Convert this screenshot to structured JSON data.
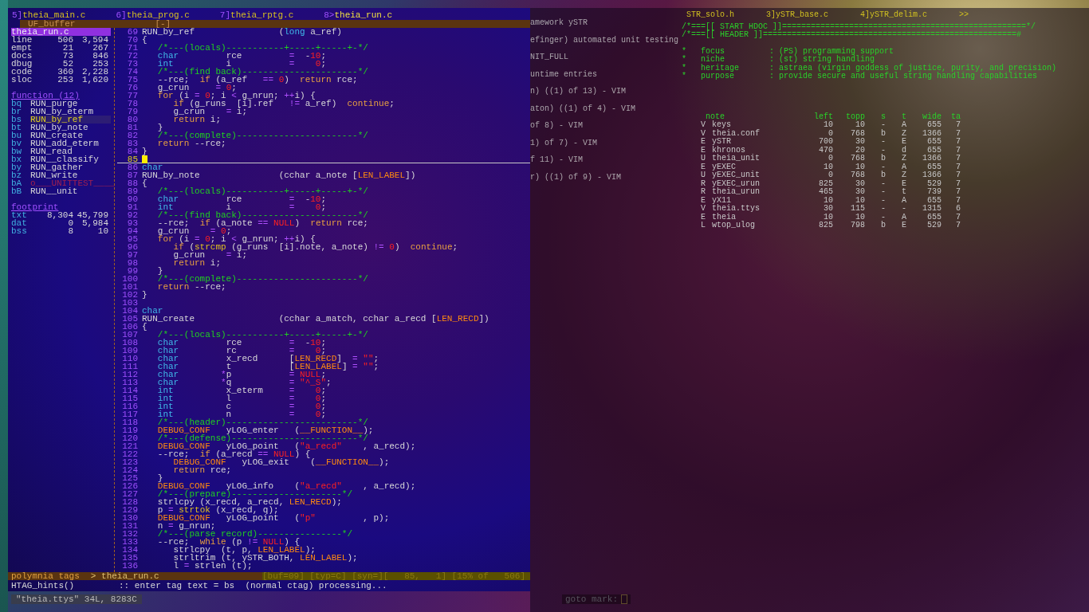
{
  "vim": {
    "tabs": [
      {
        "num": "5]",
        "name": "theia_main.c",
        "selected": false
      },
      {
        "num": "6]",
        "name": "theia_prog.c",
        "selected": false
      },
      {
        "num": "7]",
        "name": "theia_rptg.c",
        "selected": false
      },
      {
        "num": "8>",
        "name": "theia_run.c",
        "selected": true
      }
    ],
    "buffer_bar": {
      "title": "UF_buffer",
      "flag": "[-]"
    },
    "sidebar": {
      "file": "theia_run.c",
      "stats": [
        {
          "label": "line",
          "a": "506",
          "b": "3,594"
        },
        {
          "label": "empt",
          "a": "21",
          "b": "267"
        },
        {
          "label": "docs",
          "a": "73",
          "b": "846"
        },
        {
          "label": "dbug",
          "a": "52",
          "b": "253"
        },
        {
          "label": "code",
          "a": "360",
          "b": "2,228"
        },
        {
          "label": "sloc",
          "a": "253",
          "b": "1,620"
        }
      ],
      "functions_heading": "function (12)",
      "functions": [
        {
          "key": "bq",
          "name": "RUN_purge",
          "selected": false,
          "disabled": false
        },
        {
          "key": "br",
          "name": "RUN_by_eterm",
          "selected": false,
          "disabled": false
        },
        {
          "key": "bs",
          "name": "RUN_by_ref",
          "selected": true,
          "disabled": false
        },
        {
          "key": "bt",
          "name": "RUN_by_note",
          "selected": false,
          "disabled": false
        },
        {
          "key": "bu",
          "name": "RUN_create",
          "selected": false,
          "disabled": false
        },
        {
          "key": "bv",
          "name": "RUN_add_eterm",
          "selected": false,
          "disabled": false
        },
        {
          "key": "bw",
          "name": "RUN_read",
          "selected": false,
          "disabled": false
        },
        {
          "key": "bx",
          "name": "RUN__classify",
          "selected": false,
          "disabled": false
        },
        {
          "key": "by",
          "name": "RUN_gather",
          "selected": false,
          "disabled": false
        },
        {
          "key": "bz",
          "name": "RUN_write",
          "selected": false,
          "disabled": false
        },
        {
          "key": "bA",
          "name": "o___UNITTEST____",
          "selected": false,
          "disabled": true
        },
        {
          "key": "bB",
          "name": "RUN__unit",
          "selected": false,
          "disabled": false
        }
      ],
      "footprint_heading": "footprint",
      "footprint": [
        {
          "label": "txt",
          "a": "8,304",
          "b": "45,799"
        },
        {
          "label": "dat",
          "a": "0",
          "b": "5,984"
        },
        {
          "label": "bss",
          "a": "8",
          "b": "10"
        }
      ]
    },
    "lines": [
      {
        "num": "69",
        "current": false,
        "segments": [
          "RUN_by_ref                (",
          {
            "kind": "type",
            "text": "long"
          },
          " a_ref)"
        ]
      },
      {
        "num": "70",
        "current": false,
        "segments": [
          "{"
        ]
      },
      {
        "num": "71",
        "current": false,
        "segments": [
          {
            "kind": "comment",
            "text": "   /*---(locals)-----------+-----+-----+-*/"
          }
        ]
      },
      {
        "num": "72",
        "current": false,
        "segments": [
          {
            "kind": "type",
            "text": "   char"
          },
          "         rce         ",
          {
            "kind": "op",
            "text": "="
          },
          "  -",
          {
            "kind": "number",
            "text": "10"
          },
          ";"
        ]
      },
      {
        "num": "73",
        "current": false,
        "segments": [
          {
            "kind": "type",
            "text": "   int"
          },
          "          i           ",
          {
            "kind": "op",
            "text": "="
          },
          {
            "kind": "number",
            "text": "    0"
          },
          ";"
        ]
      },
      {
        "num": "74",
        "current": false,
        "segments": [
          {
            "kind": "comment",
            "text": "   /*---(find back)----------------------*/"
          }
        ]
      },
      {
        "num": "75",
        "current": false,
        "segments": [
          "   --rce;  ",
          {
            "kind": "keyword",
            "text": "if"
          },
          " (a_ref   ",
          {
            "kind": "op",
            "text": "=="
          },
          {
            "kind": "number",
            "text": " 0"
          },
          ")  ",
          {
            "kind": "keyword",
            "text": "return"
          },
          " rce;"
        ]
      },
      {
        "num": "76",
        "current": false,
        "segments": [
          "   g_crun     ",
          {
            "kind": "op",
            "text": "="
          },
          {
            "kind": "number",
            "text": " 0"
          },
          ";"
        ]
      },
      {
        "num": "77",
        "current": false,
        "segments": [
          {
            "kind": "keyword",
            "text": "   for"
          },
          " (i ",
          {
            "kind": "op",
            "text": "="
          },
          {
            "kind": "number",
            "text": " 0"
          },
          "; i ",
          {
            "kind": "op",
            "text": "<"
          },
          " g_nrun; ",
          {
            "kind": "op",
            "text": "++"
          },
          "i) {"
        ]
      },
      {
        "num": "78",
        "current": false,
        "segments": [
          {
            "kind": "keyword",
            "text": "      if"
          },
          " (g_runs  [i].ref   ",
          {
            "kind": "op",
            "text": "!="
          },
          " a_ref)  ",
          {
            "kind": "keyword",
            "text": "continue"
          },
          ";"
        ]
      },
      {
        "num": "79",
        "current": false,
        "segments": [
          "      g_crun    ",
          {
            "kind": "op",
            "text": "="
          },
          " i;"
        ]
      },
      {
        "num": "80",
        "current": false,
        "segments": [
          {
            "kind": "keyword",
            "text": "      return"
          },
          " i;"
        ]
      },
      {
        "num": "81",
        "current": false,
        "segments": [
          "   }"
        ]
      },
      {
        "num": "82",
        "current": false,
        "segments": [
          {
            "kind": "comment",
            "text": "   /*---(complete)-----------------------*/"
          }
        ]
      },
      {
        "num": "83",
        "current": false,
        "segments": [
          {
            "kind": "keyword",
            "text": "   return"
          },
          " --rce;"
        ]
      },
      {
        "num": "84",
        "current": false,
        "segments": [
          "}"
        ]
      },
      {
        "num": "85",
        "current": true
      },
      {
        "num": "86",
        "current": false,
        "segments": [
          {
            "kind": "type",
            "text": "char"
          }
        ]
      },
      {
        "num": "87",
        "current": false,
        "segments": [
          "RUN_by_note               (cchar a_note [",
          {
            "kind": "macro",
            "text": "LEN_LABEL"
          },
          "])"
        ]
      },
      {
        "num": "88",
        "current": false,
        "segments": [
          "{"
        ]
      },
      {
        "num": "89",
        "current": false,
        "segments": [
          {
            "kind": "comment",
            "text": "   /*---(locals)-----------+-----+-----+-*/"
          }
        ]
      },
      {
        "num": "90",
        "current": false,
        "segments": [
          {
            "kind": "type",
            "text": "   char"
          },
          "         rce         ",
          {
            "kind": "op",
            "text": "="
          },
          "  -",
          {
            "kind": "number",
            "text": "10"
          },
          ";"
        ]
      },
      {
        "num": "91",
        "current": false,
        "segments": [
          {
            "kind": "type",
            "text": "   int"
          },
          "          i           ",
          {
            "kind": "op",
            "text": "="
          },
          {
            "kind": "number",
            "text": "    0"
          },
          ";"
        ]
      },
      {
        "num": "92",
        "current": false,
        "segments": [
          {
            "kind": "comment",
            "text": "   /*---(find back)----------------------*/"
          }
        ]
      },
      {
        "num": "93",
        "current": false,
        "segments": [
          "   --rce;  ",
          {
            "kind": "keyword",
            "text": "if"
          },
          " (a_note ",
          {
            "kind": "op",
            "text": "=="
          },
          {
            "kind": "number",
            "text": " NULL"
          },
          ")  ",
          {
            "kind": "keyword",
            "text": "return"
          },
          " rce;"
        ]
      },
      {
        "num": "94",
        "current": false,
        "segments": [
          "   g_crun    ",
          {
            "kind": "op",
            "text": "="
          },
          {
            "kind": "number",
            "text": " 0"
          },
          ";"
        ]
      },
      {
        "num": "95",
        "current": false,
        "segments": [
          {
            "kind": "keyword",
            "text": "   for"
          },
          " (i ",
          {
            "kind": "op",
            "text": "="
          },
          {
            "kind": "number",
            "text": " 0"
          },
          "; i ",
          {
            "kind": "op",
            "text": "<"
          },
          " g_nrun; ",
          {
            "kind": "op",
            "text": "++"
          },
          "i) {"
        ]
      },
      {
        "num": "96",
        "current": false,
        "segments": [
          {
            "kind": "keyword",
            "text": "      if"
          },
          " (",
          {
            "kind": "func",
            "text": "strcmp"
          },
          " (g_runs  [i].note, a_note) ",
          {
            "kind": "op",
            "text": "!="
          },
          {
            "kind": "number",
            "text": " 0"
          },
          ")  ",
          {
            "kind": "keyword",
            "text": "continue"
          },
          ";"
        ]
      },
      {
        "num": "97",
        "current": false,
        "segments": [
          "      g_crun    ",
          {
            "kind": "op",
            "text": "="
          },
          " i;"
        ]
      },
      {
        "num": "98",
        "current": false,
        "segments": [
          {
            "kind": "keyword",
            "text": "      return"
          },
          " i;"
        ]
      },
      {
        "num": "99",
        "current": false,
        "segments": [
          "   }"
        ]
      },
      {
        "num": "100",
        "current": false,
        "segments": [
          {
            "kind": "comment",
            "text": "   /*---(complete)-----------------------*/"
          }
        ]
      },
      {
        "num": "101",
        "current": false,
        "segments": [
          {
            "kind": "keyword",
            "text": "   return"
          },
          " --rce;"
        ]
      },
      {
        "num": "102",
        "current": false,
        "segments": [
          "}"
        ]
      },
      {
        "num": "103",
        "current": false
      },
      {
        "num": "104",
        "current": false,
        "segments": [
          {
            "kind": "type",
            "text": "char"
          }
        ]
      },
      {
        "num": "105",
        "current": false,
        "segments": [
          "RUN_create                (cchar a_match, cchar a_recd [",
          {
            "kind": "macro",
            "text": "LEN_RECD"
          },
          "])"
        ]
      },
      {
        "num": "106",
        "current": false,
        "segments": [
          "{"
        ]
      },
      {
        "num": "107",
        "current": false,
        "segments": [
          {
            "kind": "comment",
            "text": "   /*---(locals)-----------+-----+-----+-*/"
          }
        ]
      },
      {
        "num": "108",
        "current": false,
        "segments": [
          {
            "kind": "type",
            "text": "   char"
          },
          "         rce         ",
          {
            "kind": "op",
            "text": "="
          },
          "  -",
          {
            "kind": "number",
            "text": "10"
          },
          ";"
        ]
      },
      {
        "num": "109",
        "current": false,
        "segments": [
          {
            "kind": "type",
            "text": "   char"
          },
          "         rc          ",
          {
            "kind": "op",
            "text": "="
          },
          {
            "kind": "number",
            "text": "    0"
          },
          ";"
        ]
      },
      {
        "num": "110",
        "current": false,
        "segments": [
          {
            "kind": "type",
            "text": "   char"
          },
          "         x_recd      [",
          {
            "kind": "macro",
            "text": "LEN_RECD"
          },
          "]  ",
          {
            "kind": "op",
            "text": "="
          },
          {
            "kind": "string",
            "text": " \"\""
          },
          ";"
        ]
      },
      {
        "num": "111",
        "current": false,
        "segments": [
          {
            "kind": "type",
            "text": "   char"
          },
          "         t           [",
          {
            "kind": "macro",
            "text": "LEN_LABEL"
          },
          "] ",
          {
            "kind": "op",
            "text": "="
          },
          {
            "kind": "string",
            "text": " \"\""
          },
          ";"
        ]
      },
      {
        "num": "112",
        "current": false,
        "segments": [
          {
            "kind": "type",
            "text": "   char"
          },
          {
            "kind": "op",
            "text": "        *"
          },
          "p           ",
          {
            "kind": "op",
            "text": "="
          },
          {
            "kind": "number",
            "text": " NULL"
          },
          ";"
        ]
      },
      {
        "num": "113",
        "current": false,
        "segments": [
          {
            "kind": "type",
            "text": "   char"
          },
          {
            "kind": "op",
            "text": "        *"
          },
          "q           ",
          {
            "kind": "op",
            "text": "="
          },
          {
            "kind": "string",
            "text": " \"^_S\""
          },
          ";"
        ]
      },
      {
        "num": "114",
        "current": false,
        "segments": [
          {
            "kind": "type",
            "text": "   int"
          },
          "          x_eterm     ",
          {
            "kind": "op",
            "text": "="
          },
          {
            "kind": "number",
            "text": "    0"
          },
          ";"
        ]
      },
      {
        "num": "115",
        "current": false,
        "segments": [
          {
            "kind": "type",
            "text": "   int"
          },
          "          l           ",
          {
            "kind": "op",
            "text": "="
          },
          {
            "kind": "number",
            "text": "    0"
          },
          ";"
        ]
      },
      {
        "num": "116",
        "current": false,
        "segments": [
          {
            "kind": "type",
            "text": "   int"
          },
          "          c           ",
          {
            "kind": "op",
            "text": "="
          },
          {
            "kind": "number",
            "text": "    0"
          },
          ";"
        ]
      },
      {
        "num": "117",
        "current": false,
        "segments": [
          {
            "kind": "type",
            "text": "   int"
          },
          "          n           ",
          {
            "kind": "op",
            "text": "="
          },
          {
            "kind": "number",
            "text": "    0"
          },
          ";"
        ]
      },
      {
        "num": "118",
        "current": false,
        "segments": [
          {
            "kind": "comment",
            "text": "   /*---(header)-------------------------*/"
          }
        ]
      },
      {
        "num": "119",
        "current": false,
        "segments": [
          {
            "kind": "macro",
            "text": "   DEBUG_CONF"
          },
          "   yLOG_enter   (",
          {
            "kind": "macro",
            "text": "__FUNCTION__"
          },
          ");"
        ]
      },
      {
        "num": "120",
        "current": false,
        "segments": [
          {
            "kind": "comment",
            "text": "   /*---(defense)------------------------*/"
          }
        ]
      },
      {
        "num": "121",
        "current": false,
        "segments": [
          {
            "kind": "macro",
            "text": "   DEBUG_CONF"
          },
          "   yLOG_point   (",
          {
            "kind": "string",
            "text": "\"a_recd\""
          },
          "    , a_recd);"
        ]
      },
      {
        "num": "122",
        "current": false,
        "segments": [
          "   --rce;  ",
          {
            "kind": "keyword",
            "text": "if"
          },
          " (a_recd ",
          {
            "kind": "op",
            "text": "=="
          },
          {
            "kind": "number",
            "text": " NULL"
          },
          ") {"
        ]
      },
      {
        "num": "123",
        "current": false,
        "segments": [
          {
            "kind": "macro",
            "text": "      DEBUG_CONF"
          },
          "   yLOG_exit    (",
          {
            "kind": "macro",
            "text": "__FUNCTION__"
          },
          ");"
        ]
      },
      {
        "num": "124",
        "current": false,
        "segments": [
          {
            "kind": "keyword",
            "text": "      return"
          },
          " rce;"
        ]
      },
      {
        "num": "125",
        "current": false,
        "segments": [
          "   }"
        ]
      },
      {
        "num": "126",
        "current": false,
        "segments": [
          {
            "kind": "macro",
            "text": "   DEBUG_CONF"
          },
          "   yLOG_info    (",
          {
            "kind": "string",
            "text": "\"a_recd\""
          },
          "    , a_recd);"
        ]
      },
      {
        "num": "127",
        "current": false,
        "segments": [
          {
            "kind": "comment",
            "text": "   /*---(prepare)---------------------*/"
          }
        ]
      },
      {
        "num": "128",
        "current": false,
        "segments": [
          "   strlcpy (x_recd, a_recd, ",
          {
            "kind": "macro",
            "text": "LEN_RECD"
          },
          ");"
        ]
      },
      {
        "num": "129",
        "current": false,
        "segments": [
          "   p ",
          {
            "kind": "op",
            "text": "="
          },
          {
            "kind": "func",
            "text": " strtok"
          },
          " (x_recd, q);"
        ]
      },
      {
        "num": "130",
        "current": false,
        "segments": [
          {
            "kind": "macro",
            "text": "   DEBUG_CONF"
          },
          "   yLOG_point   (",
          {
            "kind": "string",
            "text": "\"p\""
          },
          "         , p);"
        ]
      },
      {
        "num": "131",
        "current": false,
        "segments": [
          "   n ",
          {
            "kind": "op",
            "text": "="
          },
          " g_nrun;"
        ]
      },
      {
        "num": "132",
        "current": false,
        "segments": [
          {
            "kind": "comment",
            "text": "   /*---(parse record)----------------*/"
          }
        ]
      },
      {
        "num": "133",
        "current": false,
        "segments": [
          "   --rce;  ",
          {
            "kind": "keyword",
            "text": "while"
          },
          " (p ",
          {
            "kind": "op",
            "text": "!="
          },
          {
            "kind": "number",
            "text": " NULL"
          },
          ") {"
        ]
      },
      {
        "num": "134",
        "current": false,
        "segments": [
          "      strlcpy  (t, p, ",
          {
            "kind": "macro",
            "text": "LEN_LABEL"
          },
          ");"
        ]
      },
      {
        "num": "135",
        "current": false,
        "segments": [
          "      strltrim (t, ySTR_BOTH, ",
          {
            "kind": "macro",
            "text": "LEN_LABEL"
          },
          ");"
        ]
      },
      {
        "num": "136",
        "current": false,
        "segments": [
          "      l ",
          {
            "kind": "op",
            "text": "="
          },
          " strlen (t);"
        ]
      }
    ],
    "status": {
      "tags": "polymnia tags",
      "file": "> theia_run.c",
      "info": "[buf=09] [typ=C] [syn=]",
      "position": "[   85,   1] [15% of   506]"
    },
    "command": {
      "hint": "HTAG_hints()",
      "message": ":: enter tag text = bs  (normal ctag) processing..."
    }
  },
  "below": {
    "file_message": "\"theia.ttys\" 34L, 8283C",
    "prompt": "goto mark:"
  },
  "background_window": {
    "tabs": [
      "STR_solo.h",
      "3]ySTR_base.c",
      "4]ySTR_delim.c",
      ">>"
    ],
    "header_lines": [
      "/*===[[ START HDOC ]]===================================================*/",
      "/*===[[ HEADER ]]=====================================================#"
    ],
    "fields": [
      {
        "key": "focus",
        "value": ": (PS) programming support"
      },
      {
        "key": "niche",
        "value": ": (st) string handling"
      },
      {
        "key": "heritage",
        "value": ": astraea (virgin goddess of justice, purity, and precision)"
      },
      {
        "key": "purpose",
        "value": ": provide secure and useful string handling capabilities"
      }
    ],
    "side_lines": [
      "amework ySTR",
      "efinger) automated unit testing",
      "NIT_FULL",
      "untime entries",
      "n) ((1) of 13) - VIM",
      "aton) ((1) of 4) - VIM",
      "of 8) - VIM",
      "1) of 7) - VIM",
      "f 11) - VIM",
      "r) ((1) of 9) - VIM"
    ],
    "table_columns": [
      "note",
      "left",
      "topp",
      "s",
      "t",
      "wide",
      "ta"
    ],
    "table_rows": [
      [
        "V",
        "keys",
        "10",
        "10",
        "-",
        "A",
        "655",
        "7"
      ],
      [
        "V",
        "theia.conf",
        "0",
        "768",
        "b",
        "Z",
        "1366",
        "7"
      ],
      [
        "E",
        "ySTR",
        "700",
        "30",
        "-",
        "E",
        "655",
        "7"
      ],
      [
        "E",
        "khronos",
        "470",
        "20",
        "-",
        "d",
        "655",
        "7"
      ],
      [
        "U",
        "theia_unit",
        "0",
        "768",
        "b",
        "Z",
        "1366",
        "7"
      ],
      [
        "E",
        "yEXEC",
        "10",
        "10",
        "-",
        "A",
        "655",
        "7"
      ],
      [
        "U",
        "yEXEC_unit",
        "0",
        "768",
        "b",
        "Z",
        "1366",
        "7"
      ],
      [
        "R",
        "yEXEC_urun",
        "825",
        "30",
        "-",
        "E",
        "529",
        "7"
      ],
      [
        "R",
        "theia_urun",
        "465",
        "30",
        "-",
        "t",
        "739",
        "7"
      ],
      [
        "E",
        "yX11",
        "10",
        "10",
        "-",
        "A",
        "655",
        "7"
      ],
      [
        "V",
        "theia.ttys",
        "30",
        "115",
        "-",
        "-",
        "1315",
        "6"
      ],
      [
        "E",
        "theia",
        "10",
        "10",
        "-",
        "A",
        "655",
        "7"
      ],
      [
        "L",
        "wtop_ulog",
        "825",
        "798",
        "b",
        "E",
        "529",
        "7"
      ]
    ]
  }
}
